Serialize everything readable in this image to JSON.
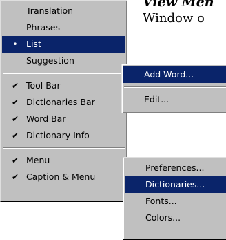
{
  "background": {
    "title": "View Men",
    "line": "Window o"
  },
  "main_menu": {
    "items": [
      {
        "label": "Translation",
        "mark": ""
      },
      {
        "label": "Phrases",
        "mark": ""
      },
      {
        "label": "List",
        "mark": "•"
      },
      {
        "label": "Suggestion",
        "mark": ""
      },
      {
        "label": "Tool Bar",
        "mark": "✔"
      },
      {
        "label": "Dictionaries Bar",
        "mark": "✔"
      },
      {
        "label": "Word Bar",
        "mark": "✔"
      },
      {
        "label": "Dictionary Info",
        "mark": "✔"
      },
      {
        "label": "Menu",
        "mark": "✔"
      },
      {
        "label": "Caption & Menu",
        "mark": "✔"
      }
    ]
  },
  "list_submenu": {
    "items": [
      {
        "label": "Add Word..."
      },
      {
        "label": "Edit..."
      }
    ]
  },
  "menu_submenu": {
    "items": [
      {
        "label": "Preferences..."
      },
      {
        "label": "Dictionaries..."
      },
      {
        "label": "Fonts..."
      },
      {
        "label": "Colors..."
      }
    ]
  },
  "colors": {
    "menu_face": "#c0c0c0",
    "highlight": "#0a246a",
    "highlight_text": "#ffffff"
  }
}
